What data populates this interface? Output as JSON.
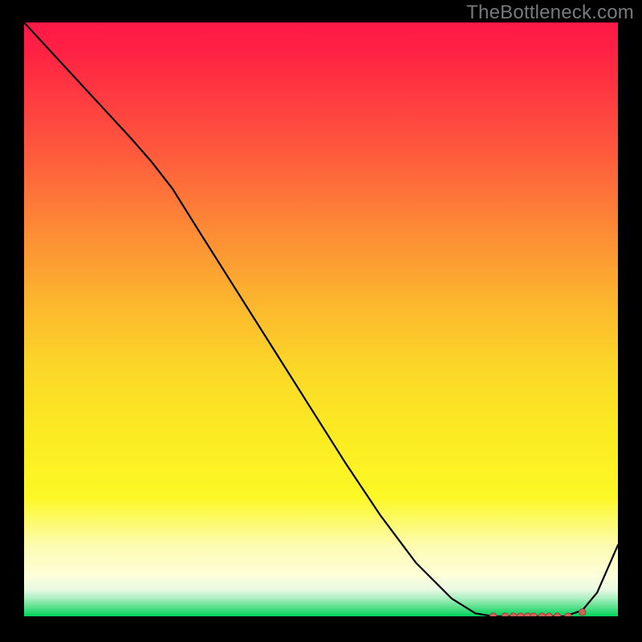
{
  "watermark": "TheBottleneck.com",
  "colors": {
    "background": "#000000",
    "watermark_text": "#787b7e",
    "line": "#000000",
    "marker_fill": "#cf625a",
    "marker_stroke": "#9e3d37",
    "gradient_stops": [
      {
        "offset": 0.0,
        "color": "#ff1846"
      },
      {
        "offset": 0.04,
        "color": "#ff1f44"
      },
      {
        "offset": 0.12,
        "color": "#ff3941"
      },
      {
        "offset": 0.22,
        "color": "#fe5a3d"
      },
      {
        "offset": 0.34,
        "color": "#fd8736"
      },
      {
        "offset": 0.46,
        "color": "#fcb22f"
      },
      {
        "offset": 0.58,
        "color": "#fbd728"
      },
      {
        "offset": 0.7,
        "color": "#fbec22"
      },
      {
        "offset": 0.8,
        "color": "#fcf826"
      },
      {
        "offset": 0.88,
        "color": "#fdfcb0"
      },
      {
        "offset": 0.93,
        "color": "#fefed8"
      },
      {
        "offset": 0.955,
        "color": "#e9fae4"
      },
      {
        "offset": 0.97,
        "color": "#a9efc0"
      },
      {
        "offset": 0.985,
        "color": "#56e08a"
      },
      {
        "offset": 1.0,
        "color": "#00d25a"
      }
    ]
  },
  "chart_data": {
    "type": "line",
    "title": "",
    "xlabel": "",
    "ylabel": "",
    "xlim": [
      0,
      1
    ],
    "ylim": [
      0,
      1
    ],
    "x": [
      0.0,
      0.06,
      0.12,
      0.18,
      0.215,
      0.25,
      0.3,
      0.36,
      0.42,
      0.48,
      0.54,
      0.6,
      0.66,
      0.72,
      0.76,
      0.79,
      0.82,
      0.85,
      0.88,
      0.91,
      0.94,
      0.965,
      1.0
    ],
    "y": [
      1.0,
      0.935,
      0.87,
      0.805,
      0.765,
      0.72,
      0.64,
      0.545,
      0.45,
      0.355,
      0.26,
      0.17,
      0.09,
      0.03,
      0.005,
      0.0,
      0.0,
      0.0,
      0.0,
      0.0,
      0.01,
      0.04,
      0.12
    ],
    "markers": {
      "x": [
        0.79,
        0.81,
        0.824,
        0.836,
        0.848,
        0.858,
        0.872,
        0.884,
        0.898,
        0.916,
        0.94
      ],
      "y": [
        0.0,
        0.0,
        0.0,
        0.0,
        0.0,
        0.0,
        0.0,
        0.0,
        0.0,
        0.0,
        0.007
      ]
    }
  }
}
